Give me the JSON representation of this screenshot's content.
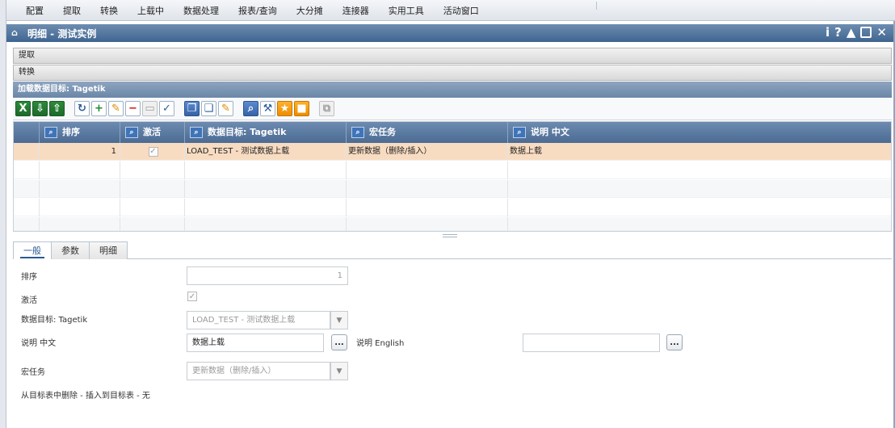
{
  "menubar": {
    "items": [
      "配置",
      "提取",
      "转换",
      "上载中",
      "数据处理",
      "报表/查询",
      "大分摊",
      "连接器",
      "实用工具",
      "活动窗口"
    ]
  },
  "window": {
    "title": "明细 - 测试实例",
    "tools": [
      "i",
      "?",
      "▲"
    ]
  },
  "panels": {
    "extract": "提取",
    "transform": "转换"
  },
  "section": {
    "title": "加载数据目标: Tagetik"
  },
  "grid": {
    "columns": [
      "排序",
      "激活",
      "数据目标: Tagetik",
      "宏任务",
      "说明 中文"
    ],
    "rows": [
      {
        "order": "1",
        "active": true,
        "target": "LOAD_TEST - 测试数据上载",
        "macro": "更新数据（删除/插入）",
        "desc": "数据上载"
      }
    ]
  },
  "tabs": [
    "一般",
    "参数",
    "明细"
  ],
  "form": {
    "order_label": "排序",
    "order_value": "1",
    "active_label": "激活",
    "target_label": "数据目标: Tagetik",
    "target_value": "LOAD_TEST - 测试数据上载",
    "desc_cn_label": "说明 中文",
    "desc_cn_value": "数据上载",
    "desc_en_label": "说明 English",
    "desc_en_value": "",
    "macro_label": "宏任务",
    "macro_value": "更新数据（删除/插入）",
    "footer_text": "从目标表中删除 - 插入到目标表 - 无",
    "more_button": "..."
  },
  "colors": {
    "title_bar": "#4b6b93",
    "selected_row": "#f8dcc2",
    "toolbar_green": "#1d6b2a",
    "toolbar_orange": "#ee8c00"
  }
}
